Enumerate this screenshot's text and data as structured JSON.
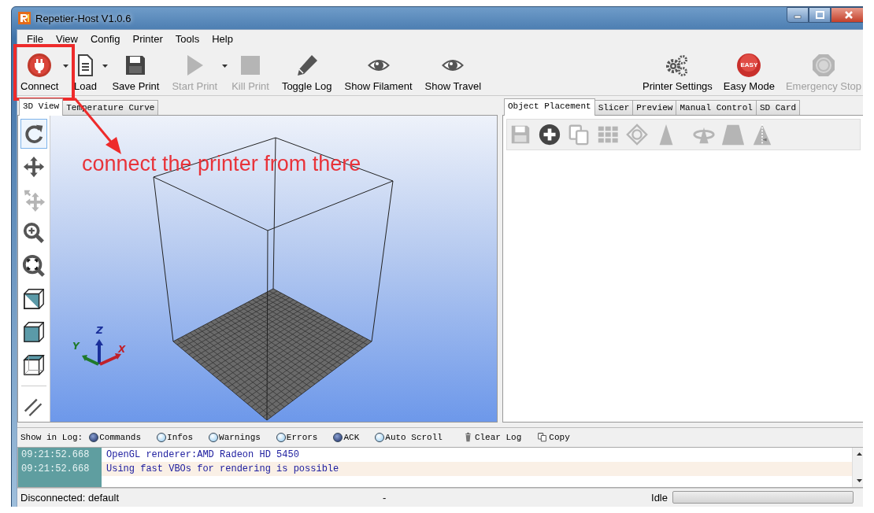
{
  "window": {
    "title": "Repetier-Host V1.0.6"
  },
  "menu": [
    "File",
    "View",
    "Config",
    "Printer",
    "Tools",
    "Help"
  ],
  "toolbar": {
    "left": [
      {
        "kind": "connect",
        "label": "Connect",
        "disabled": false,
        "dropdown": true
      },
      {
        "kind": "load",
        "label": "Load",
        "disabled": false,
        "dropdown": true
      },
      {
        "kind": "save",
        "label": "Save Print",
        "disabled": false,
        "dropdown": false
      },
      {
        "kind": "play",
        "label": "Start Print",
        "disabled": true,
        "dropdown": true
      },
      {
        "kind": "stop",
        "label": "Kill Print",
        "disabled": true,
        "dropdown": false
      },
      {
        "kind": "pencil",
        "label": "Toggle Log",
        "disabled": false,
        "dropdown": false
      },
      {
        "kind": "eye",
        "label": "Show Filament",
        "disabled": false,
        "dropdown": false
      },
      {
        "kind": "eye",
        "label": "Show Travel",
        "disabled": false,
        "dropdown": false
      }
    ],
    "right": [
      {
        "kind": "gears",
        "label": "Printer Settings",
        "disabled": false
      },
      {
        "kind": "easy",
        "label": "Easy Mode",
        "badge": "EASY",
        "disabled": false
      },
      {
        "kind": "estop",
        "label": "Emergency Stop",
        "disabled": true
      }
    ]
  },
  "view_tabs": [
    {
      "label": "3D View",
      "selected": true
    },
    {
      "label": "Temperature Curve",
      "selected": false
    }
  ],
  "view_tools": [
    {
      "kind": "rotate",
      "selected": true,
      "disabled": false
    },
    {
      "kind": "move",
      "selected": false,
      "disabled": false
    },
    {
      "kind": "move-object",
      "selected": false,
      "disabled": true
    },
    {
      "kind": "zoom",
      "selected": false,
      "disabled": false
    },
    {
      "kind": "fit",
      "selected": false,
      "disabled": false
    },
    {
      "kind": "cube-iso",
      "selected": false,
      "disabled": false
    },
    {
      "kind": "cube-front",
      "selected": false,
      "disabled": false
    },
    {
      "kind": "cube-top",
      "selected": false,
      "disabled": false
    },
    {
      "kind": "parallel",
      "selected": false,
      "disabled": false
    }
  ],
  "axes": {
    "x": "X",
    "y": "Y",
    "z": "Z"
  },
  "panel_tabs": [
    {
      "label": "Object Placement",
      "selected": true
    },
    {
      "label": "Slicer",
      "selected": false
    },
    {
      "label": "Preview",
      "selected": false
    },
    {
      "label": "Manual Control",
      "selected": false
    },
    {
      "label": "SD Card",
      "selected": false
    }
  ],
  "panel_tools": [
    {
      "kind": "save",
      "disabled": true
    },
    {
      "kind": "add",
      "disabled": false
    },
    {
      "kind": "copy",
      "disabled": true
    },
    {
      "kind": "grid",
      "disabled": true
    },
    {
      "kind": "center",
      "disabled": true
    },
    {
      "kind": "cone",
      "disabled": true
    },
    {
      "kind": "rotate3d",
      "disabled": true
    },
    {
      "kind": "scale",
      "disabled": true
    },
    {
      "kind": "mirror",
      "disabled": true
    }
  ],
  "log": {
    "label": "Show in Log:",
    "options": [
      {
        "label": "Commands",
        "checked": true
      },
      {
        "label": "Infos",
        "checked": false
      },
      {
        "label": "Warnings",
        "checked": false
      },
      {
        "label": "Errors",
        "checked": false
      },
      {
        "label": "ACK",
        "checked": true
      },
      {
        "label": "Auto Scroll",
        "checked": false
      }
    ],
    "actions": [
      {
        "kind": "trash",
        "label": "Clear Log"
      },
      {
        "kind": "copy",
        "label": "Copy"
      }
    ],
    "rows": [
      {
        "time": "09:21:52.668",
        "message": "OpenGL renderer:AMD Radeon HD 5450"
      },
      {
        "time": "09:21:52.668",
        "message": "Using fast VBOs for rendering is possible"
      }
    ]
  },
  "status_bar": {
    "connection": "Disconnected: default",
    "separator": "-",
    "state": "Idle",
    "progress": {
      "level": 0
    }
  },
  "annotation": {
    "text": "connect the printer from there"
  }
}
